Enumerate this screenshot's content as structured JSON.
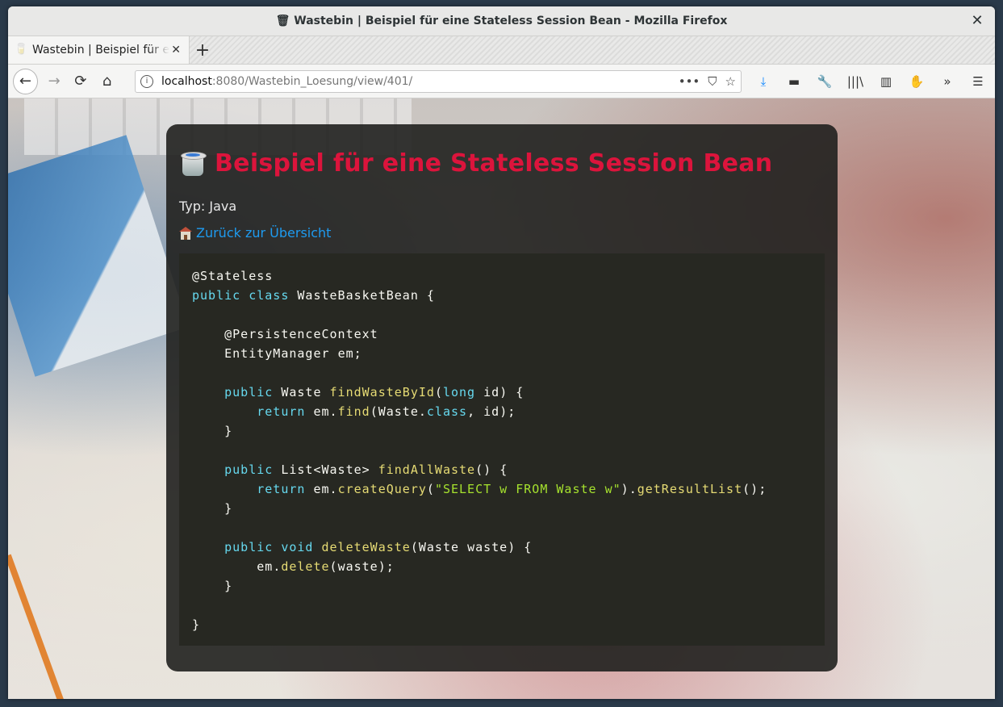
{
  "window": {
    "title": "🗑 Wastebin | Beispiel für eine Stateless Session Bean - Mozilla Firefox",
    "close_glyph": "✕"
  },
  "tabs": [
    {
      "label": "Wastebin | Beispiel für eine Stateless Session Bean",
      "favicon": "🥛",
      "close_glyph": "✕"
    }
  ],
  "toolbar": {
    "new_tab_glyph": "+",
    "back_glyph": "←",
    "forward_glyph": "→",
    "reload_glyph": "⟳",
    "home_glyph": "⌂",
    "info_glyph": "i",
    "url_host": "localhost",
    "url_rest": ":8080/Wastebin_Loesung/view/401/",
    "page_actions_glyph": "•••",
    "pocket_glyph": "⛉",
    "bookmark_glyph": "☆",
    "download_glyph": "⤓",
    "extension_glyph": "▬",
    "tools_glyph": "🔧",
    "library_glyph": "|||\\",
    "sidebar_glyph": "▥",
    "gnome_glyph": "✋",
    "overflow_glyph": "»",
    "menu_glyph": "☰"
  },
  "page": {
    "title": "Beispiel für eine Stateless Session Bean",
    "type_line": "Typ: Java",
    "back_link": "Zurück zur Übersicht"
  },
  "code": {
    "lines": [
      "@Stateless",
      "public class WasteBasketBean {",
      "",
      "    @PersistenceContext",
      "    EntityManager em;",
      "",
      "    public Waste findWasteById(long id) {",
      "        return em.find(Waste.class, id);",
      "    }",
      "",
      "    public List<Waste> findAllWaste() {",
      "        return em.createQuery(\"SELECT w FROM Waste w\").getResultList();",
      "    }",
      "",
      "    public void deleteWaste(Waste waste) {",
      "        em.delete(waste);",
      "    }",
      "",
      "}"
    ]
  },
  "colors": {
    "title": "#dc143c",
    "link": "#1e9bf0",
    "code_bg": "#272822",
    "keyword": "#66d9ef",
    "function": "#e6db74",
    "string": "#a6e22e"
  }
}
